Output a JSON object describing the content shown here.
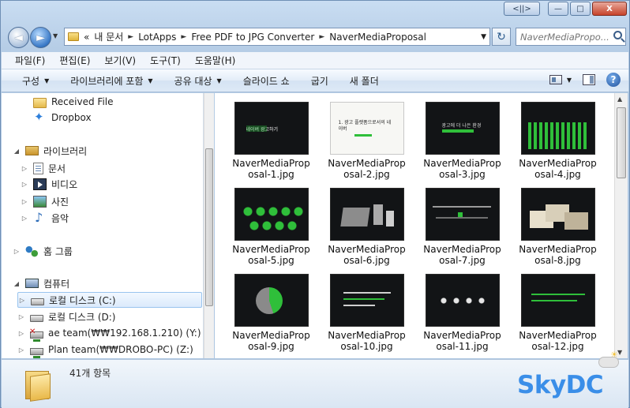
{
  "window": {
    "caption": {
      "back_forward": "<||>",
      "minimize": "—",
      "maximize": "□",
      "close": "X"
    }
  },
  "nav": {
    "back_glyph": "◄",
    "forward_glyph": "►",
    "history_caret": "▼",
    "address": {
      "overflow": "«",
      "crumbs": [
        "내 문서",
        "LotApps",
        "Free PDF to JPG Converter",
        "NaverMediaProposal"
      ],
      "separator": "►",
      "dropdown": "▼"
    },
    "refresh": "↻",
    "search_placeholder": "NaverMediaPropo..."
  },
  "menubar": [
    "파일(F)",
    "편집(E)",
    "보기(V)",
    "도구(T)",
    "도움말(H)"
  ],
  "commands": [
    {
      "label": "구성",
      "caret": "▼"
    },
    {
      "label": "라이브러리에 포함",
      "caret": "▼"
    },
    {
      "label": "공유 대상",
      "caret": "▼"
    },
    {
      "label": "슬라이드 쇼",
      "caret": ""
    },
    {
      "label": "굽기",
      "caret": ""
    },
    {
      "label": "새 폴더",
      "caret": ""
    }
  ],
  "command_right": {
    "view_caret": "▼",
    "help": "?"
  },
  "tree": [
    {
      "label": "Received File",
      "icon": "folder-icon",
      "arrow": ""
    },
    {
      "label": "Dropbox",
      "icon": "dropbox-icon",
      "arrow": ""
    },
    {
      "label": "라이브러리",
      "icon": "library-icon",
      "arrow": "◢"
    },
    {
      "label": "문서",
      "icon": "documents-icon",
      "arrow": "▷"
    },
    {
      "label": "비디오",
      "icon": "video-icon",
      "arrow": "▷"
    },
    {
      "label": "사진",
      "icon": "pictures-icon",
      "arrow": "▷"
    },
    {
      "label": "음악",
      "icon": "music-icon",
      "arrow": "▷"
    },
    {
      "label": "홈 그룹",
      "icon": "homegroup-icon",
      "arrow": "▷"
    },
    {
      "label": "컴퓨터",
      "icon": "computer-icon",
      "arrow": "◢"
    },
    {
      "label": "로컬 디스크 (C:)",
      "icon": "local-disk-icon",
      "arrow": "▷"
    },
    {
      "label": "로컬 디스크 (D:)",
      "icon": "local-disk-icon",
      "arrow": "▷"
    },
    {
      "label": "ae team(₩₩192.168.1.210) (Y:)",
      "icon": "network-drive-disconnected-icon",
      "arrow": "▷"
    },
    {
      "label": "Plan team(₩₩DROBO-PC) (Z:)",
      "icon": "network-drive-icon",
      "arrow": "▷"
    }
  ],
  "files": [
    "NaverMediaProposal-1.jpg",
    "NaverMediaProposal-2.jpg",
    "NaverMediaProposal-3.jpg",
    "NaverMediaProposal-4.jpg",
    "NaverMediaProposal-5.jpg",
    "NaverMediaProposal-6.jpg",
    "NaverMediaProposal-7.jpg",
    "NaverMediaProposal-8.jpg",
    "NaverMediaProposal-9.jpg",
    "NaverMediaProposal-10.jpg",
    "NaverMediaProposal-11.jpg",
    "NaverMediaProposal-12.jpg"
  ],
  "slide_text": {
    "s1": "네이버 광고하기",
    "s2_title": "1. 광고 플랫폼으로서의 네이버",
    "s3": "광고에 더 나은 환경"
  },
  "details": {
    "count": "41개 항목"
  },
  "watermark": "SkyDC",
  "colors": {
    "accent": "#3a8ee8",
    "slide_green": "#2fbf3a",
    "selection": "#dbeafc"
  }
}
